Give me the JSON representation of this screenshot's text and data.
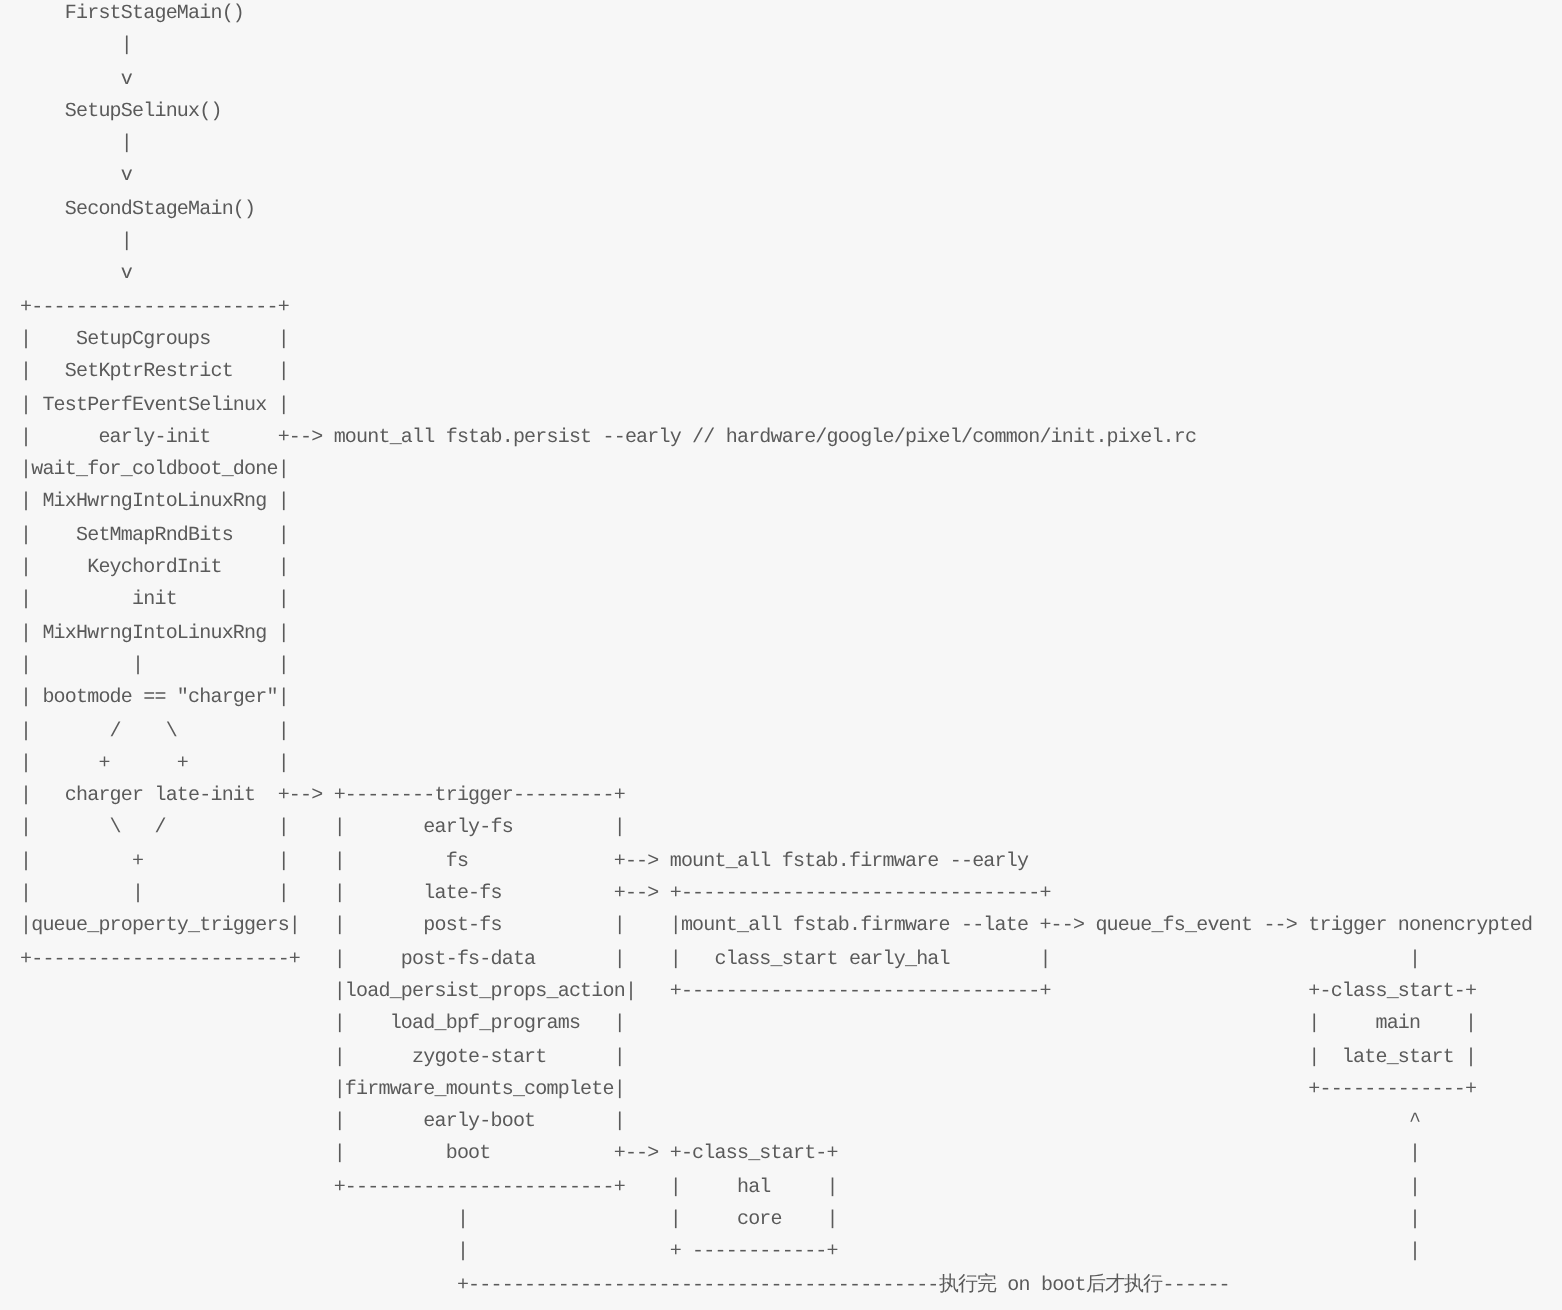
{
  "code_block": {
    "lines": [
      "    FirstStageMain()",
      "         |",
      "         v",
      "    SetupSelinux()",
      "         |",
      "         v",
      "    SecondStageMain()",
      "         |",
      "         v",
      "+----------------------+",
      "|    SetupCgroups      |",
      "|   SetKptrRestrict    |",
      "| TestPerfEventSelinux |",
      "|      early-init      +--> mount_all fstab.persist --early // hardware/google/pixel/common/init.pixel.rc",
      "|wait_for_coldboot_done|",
      "| MixHwrngIntoLinuxRng |",
      "|    SetMmapRndBits    |",
      "|     KeychordInit     |",
      "|         init         |",
      "| MixHwrngIntoLinuxRng |",
      "|         |            |",
      "| bootmode == \"charger\"|",
      "|       /    \\         |",
      "|      +      +        |",
      "|   charger late-init  +--> +--------trigger---------+",
      "|       \\   /          |    |       early-fs         |",
      "|         +            |    |         fs             +--> mount_all fstab.firmware --early",
      "|         |            |    |       late-fs          +--> +--------------------------------+",
      "|queue_property_triggers|   |       post-fs          |    |mount_all fstab.firmware --late +--> queue_fs_event --> trigger nonencrypted",
      "+-----------------------+   |     post-fs-data       |    |   class_start early_hal        |                                |",
      "                            |load_persist_props_action|   +--------------------------------+                       +-class_start-+",
      "                            |    load_bpf_programs   |                                                             |     main    |",
      "                            |      zygote-start      |                                                             |  late_start |",
      "                            |firmware_mounts_complete|                                                             +-------------+",
      "                            |       early-boot       |                                                                      ^",
      "                            |         boot           +--> +-class_start-+                                                   |",
      "                            +------------------------+    |     hal     |                                                   |",
      "                                       |                  |     core    |                                                   |",
      "                                       |                  + ------------+                                                   |",
      "                                       +------------------------------------------执行完 on boot后才执行------"
    ]
  }
}
